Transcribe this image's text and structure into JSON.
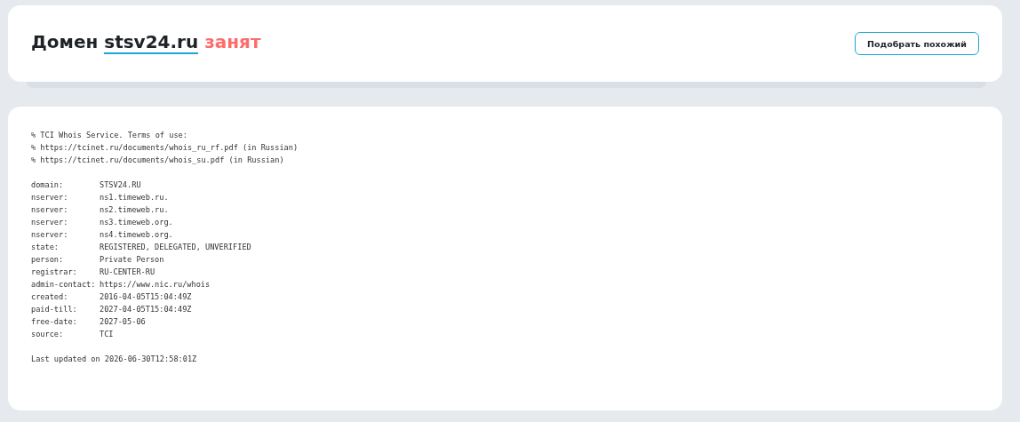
{
  "header": {
    "title_prefix": "Домен",
    "domain": "stsv24.ru",
    "status": "занят",
    "button": "Подобрать похожий"
  },
  "whois": {
    "notes": [
      "% TCI Whois Service. Terms of use:",
      "% https://tcinet.ru/documents/whois_ru_rf.pdf (in Russian)",
      "% https://tcinet.ru/documents/whois_su.pdf (in Russian)"
    ],
    "records": [
      {
        "key": "domain:",
        "value": "STSV24.RU"
      },
      {
        "key": "nserver:",
        "value": "ns1.timeweb.ru."
      },
      {
        "key": "nserver:",
        "value": "ns2.timeweb.ru."
      },
      {
        "key": "nserver:",
        "value": "ns3.timeweb.org."
      },
      {
        "key": "nserver:",
        "value": "ns4.timeweb.org."
      },
      {
        "key": "state:",
        "value": "REGISTERED, DELEGATED, UNVERIFIED"
      },
      {
        "key": "person:",
        "value": "Private Person"
      },
      {
        "key": "registrar:",
        "value": "RU-CENTER-RU"
      },
      {
        "key": "admin-contact:",
        "value": "https://www.nic.ru/whois"
      },
      {
        "key": "created:",
        "value": "2016-04-05T15:04:49Z"
      },
      {
        "key": "paid-till:",
        "value": "2027-04-05T15:04:49Z"
      },
      {
        "key": "free-date:",
        "value": "2027-05-06"
      },
      {
        "key": "source:",
        "value": "TCI"
      }
    ],
    "footer": "Last updated on 2026-06-30T12:58:01Z"
  }
}
